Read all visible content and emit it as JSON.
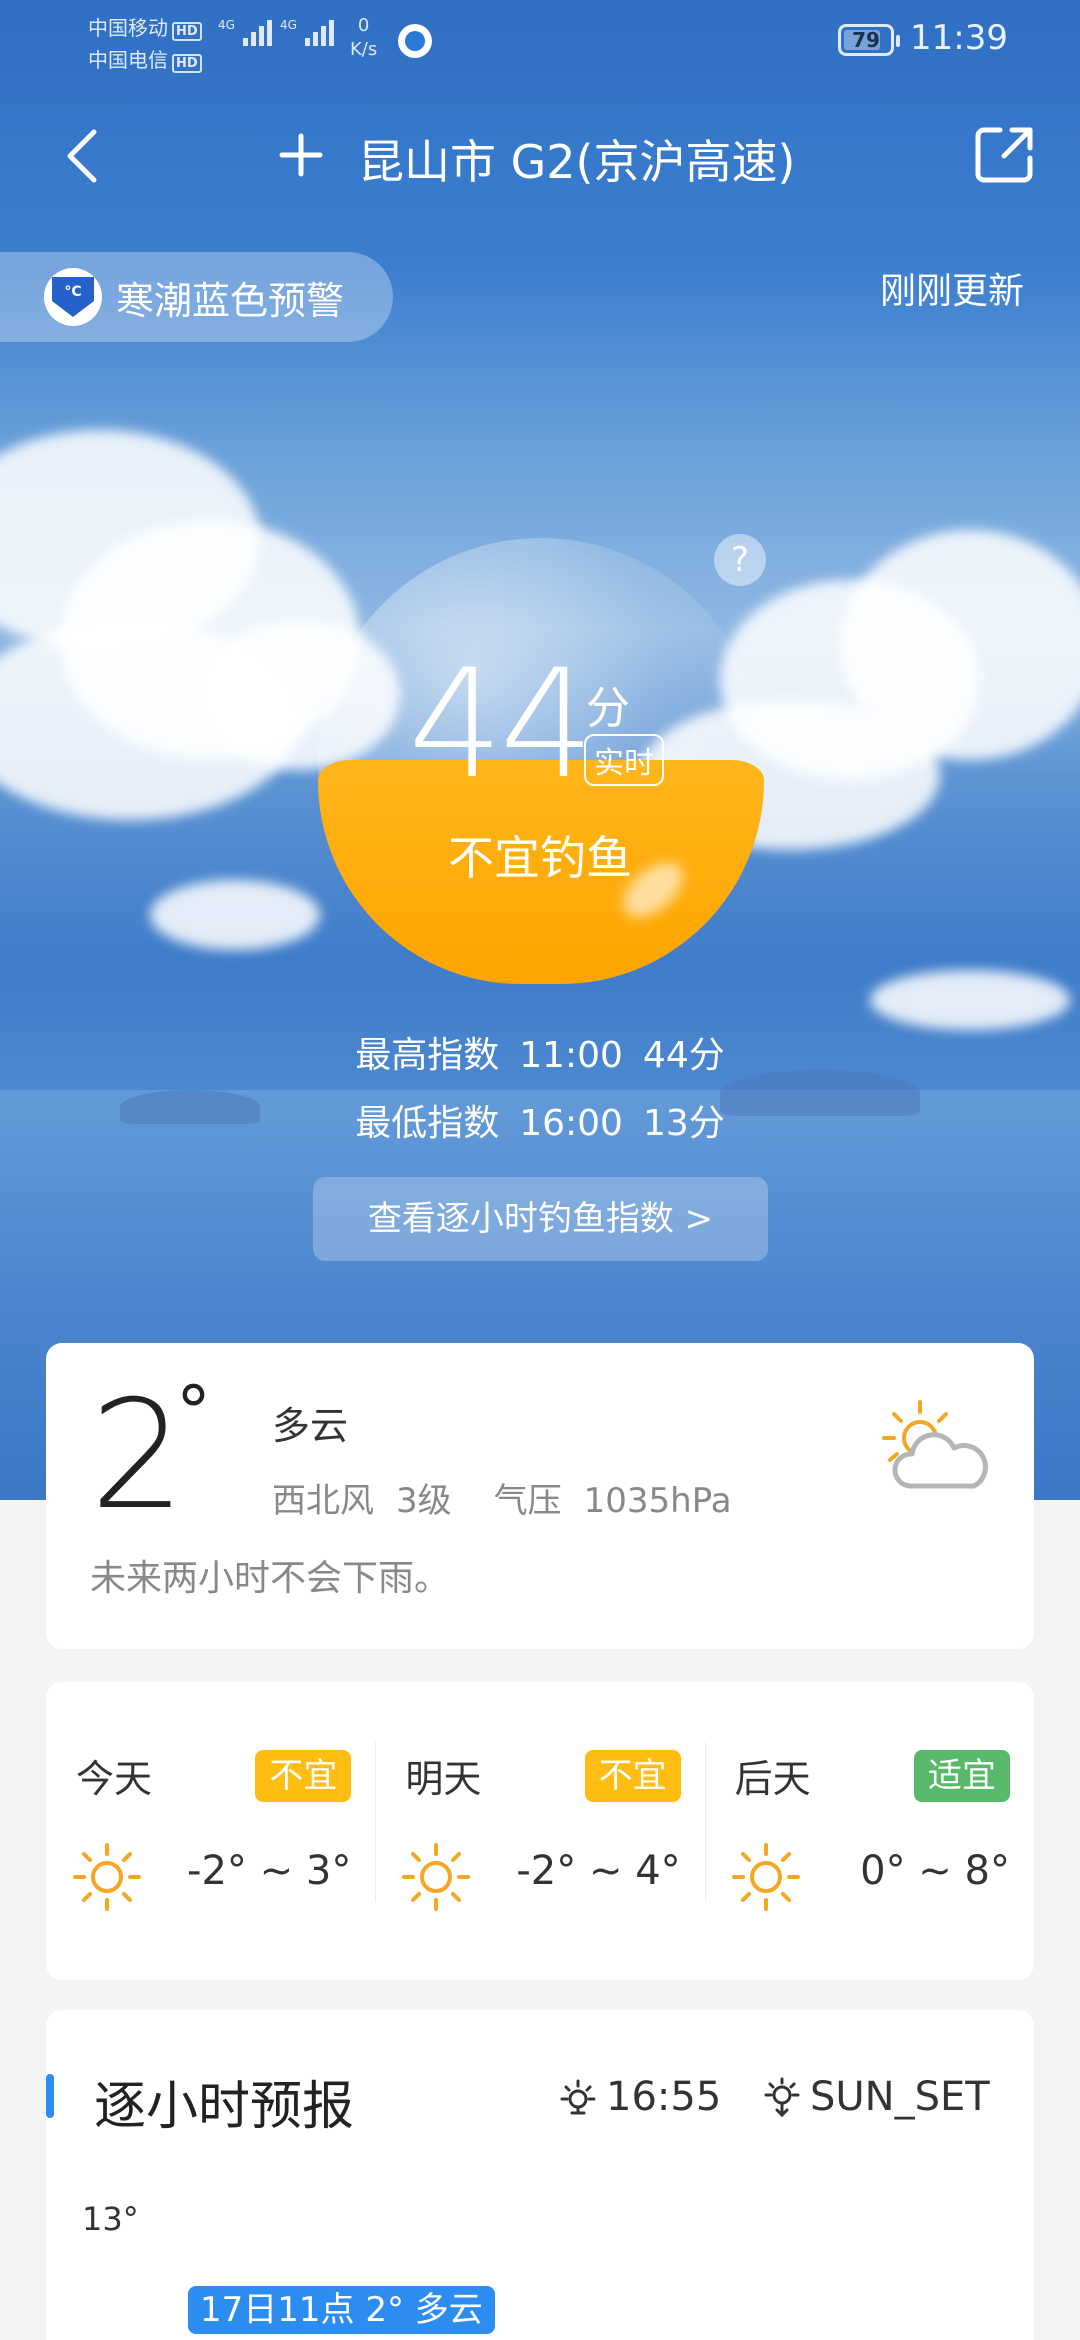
{
  "status_bar": {
    "carrier1": "中国移动",
    "carrier2": "中国电信",
    "hd": "HD",
    "net_type": "4G",
    "speed_value": "0",
    "speed_unit": "K/s",
    "battery": "79",
    "time": "11:39"
  },
  "header": {
    "title": "昆山市 G2(京沪高速)"
  },
  "alert": {
    "text": "寒潮蓝色预警"
  },
  "updated": "刚刚更新",
  "score": {
    "value": "44",
    "unit": "分",
    "realtime_label": "实时",
    "verdict": "不宜钓鱼",
    "help": "?"
  },
  "max_index": {
    "label": "最高指数",
    "time": "11:00",
    "score": "44分"
  },
  "min_index": {
    "label": "最低指数",
    "time": "16:00",
    "score": "13分"
  },
  "hourly_button": "查看逐小时钓鱼指数 >",
  "now": {
    "temp": "2",
    "deg": "°",
    "condition": "多云",
    "wind": "西北风",
    "wind_level": "3级",
    "pressure_label": "气压",
    "pressure": "1035hPa",
    "rain": "未来两小时不会下雨。",
    "icon": "cloud-sun-icon"
  },
  "forecast": [
    {
      "day": "今天",
      "badge": "不宜",
      "badge_color": "#ffbd12",
      "range": "-2° ~ 3°",
      "icon": "sun-icon"
    },
    {
      "day": "明天",
      "badge": "不宜",
      "badge_color": "#ffbd12",
      "range": "-2° ~ 4°",
      "icon": "sun-icon"
    },
    {
      "day": "后天",
      "badge": "适宜",
      "badge_color": "#58b96b",
      "range": "0° ~ 8°",
      "icon": "sun-icon"
    }
  ],
  "hourly": {
    "title": "逐小时预报",
    "sunrise": "16:55",
    "sunset": "SUN_SET",
    "ymax": "13°",
    "tooltip": "17日11点 2° 多云"
  },
  "colors": {
    "accent_blue": "#2d8cf0",
    "orange": "#ffa400"
  }
}
